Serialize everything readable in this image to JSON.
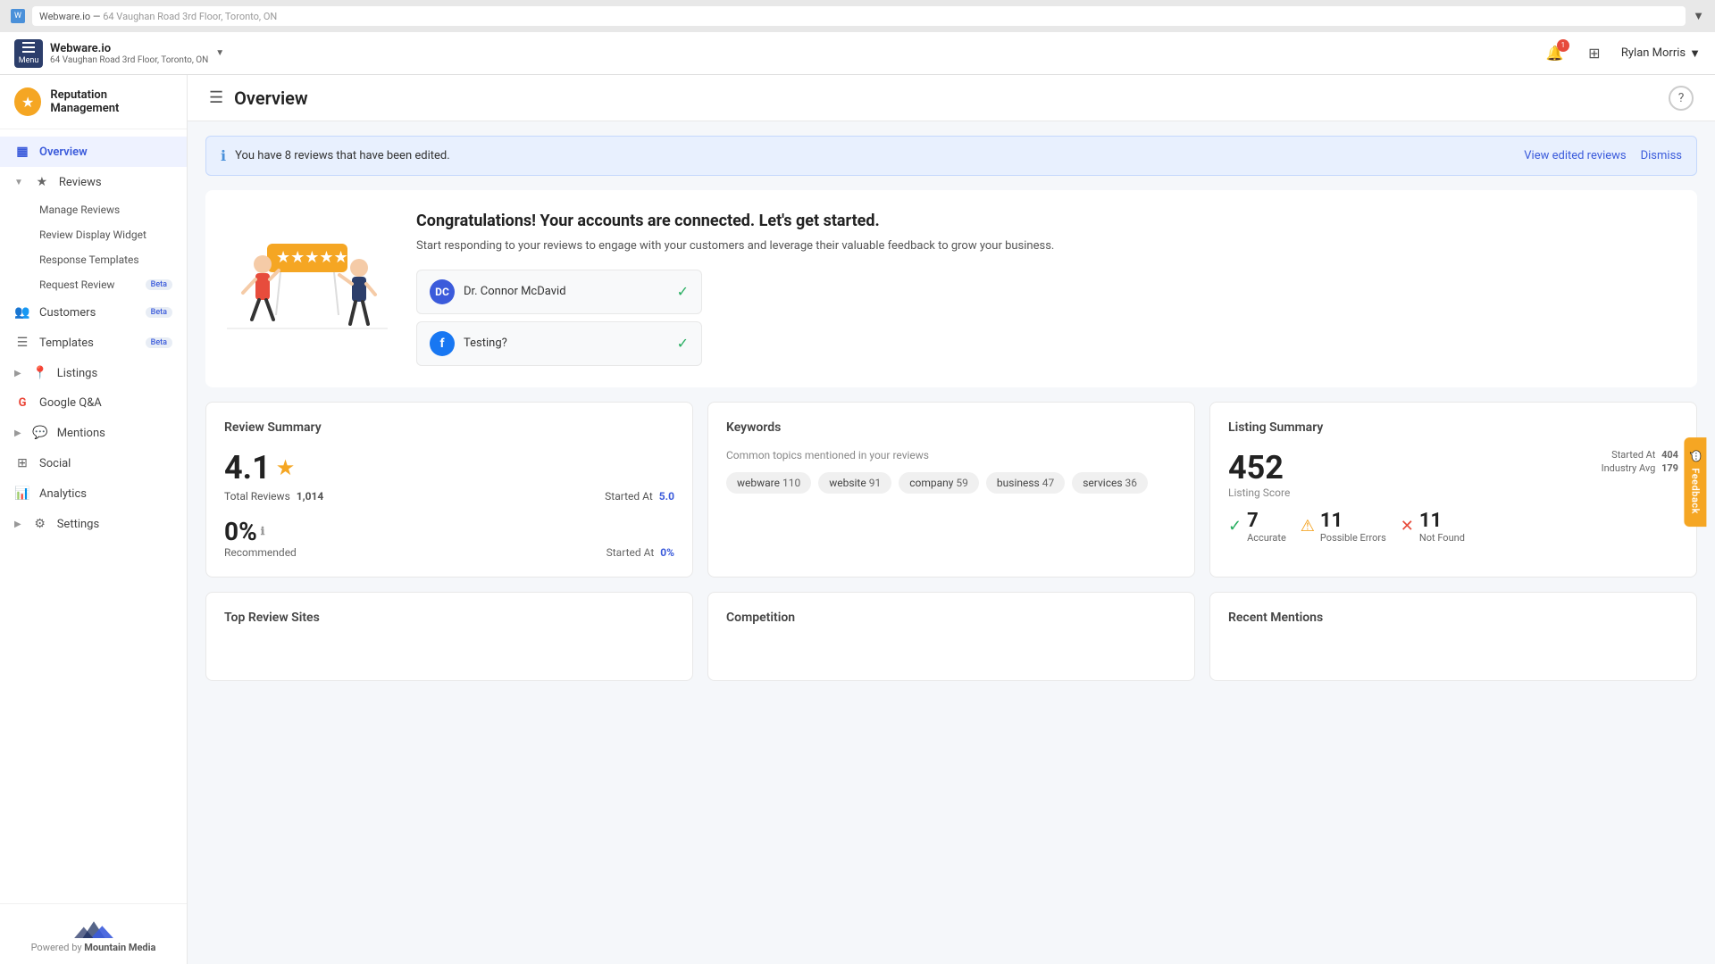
{
  "browser": {
    "company": "Webware.io",
    "address": "64 Vaughan Road 3rd Floor, Toronto, ON",
    "menu_label": "Menu",
    "user": "Rylan Morris"
  },
  "header": {
    "page_title": "Overview",
    "notif_count": "1"
  },
  "sidebar": {
    "brand_name": "Reputation Management",
    "nav_items": [
      {
        "id": "overview",
        "label": "Overview",
        "icon": "▦",
        "active": true
      },
      {
        "id": "reviews",
        "label": "Reviews",
        "icon": "★",
        "expandable": true
      },
      {
        "id": "manage-reviews",
        "label": "Manage Reviews",
        "sub": true
      },
      {
        "id": "review-display-widget",
        "label": "Review Display Widget",
        "sub": true
      },
      {
        "id": "response-templates",
        "label": "Response Templates",
        "sub": true
      },
      {
        "id": "request-review",
        "label": "Request Review",
        "sub": true,
        "badge": "Beta"
      },
      {
        "id": "customers",
        "label": "Customers",
        "icon": "👥",
        "badge": "Beta"
      },
      {
        "id": "templates",
        "label": "Templates",
        "icon": "☰",
        "badge": "Beta"
      },
      {
        "id": "listings",
        "label": "Listings",
        "icon": "📍",
        "expandable": true
      },
      {
        "id": "google-qa",
        "label": "Google Q&A",
        "icon": "G"
      },
      {
        "id": "mentions",
        "label": "Mentions",
        "icon": "💬",
        "expandable": true
      },
      {
        "id": "social",
        "label": "Social",
        "icon": "⊞"
      },
      {
        "id": "analytics",
        "label": "Analytics",
        "icon": "📊"
      },
      {
        "id": "settings",
        "label": "Settings",
        "icon": "⚙",
        "expandable": true
      }
    ],
    "footer_powered_by": "Powered by",
    "footer_company": "Mountain Media"
  },
  "info_banner": {
    "message": "You have 8 reviews that have been edited.",
    "view_link": "View edited reviews",
    "dismiss": "Dismiss"
  },
  "welcome": {
    "title": "Congratulations! Your accounts are connected. Let's get started.",
    "description": "Start responding to your reviews to engage with your customers and leverage their valuable feedback to grow your business.",
    "connected_accounts": [
      {
        "id": "dr-connor",
        "name": "Dr. Connor McDavid",
        "initials": "DC",
        "type": "blue"
      },
      {
        "id": "testing",
        "name": "Testing?",
        "initials": "f",
        "type": "fb"
      }
    ]
  },
  "review_summary": {
    "title": "Review Summary",
    "rating": "4.1",
    "total_reviews_label": "Total Reviews",
    "total_reviews_value": "1,014",
    "started_at_label": "Started At",
    "started_at_value": "5.0",
    "recommended_percent": "0%",
    "recommended_label": "Recommended",
    "rec_started_at_label": "Started At",
    "rec_started_at_value": "0%"
  },
  "keywords": {
    "title": "Keywords",
    "description": "Common topics mentioned in your reviews",
    "tags": [
      {
        "word": "webware",
        "count": "110"
      },
      {
        "word": "website",
        "count": "91"
      },
      {
        "word": "company",
        "count": "59"
      },
      {
        "word": "business",
        "count": "47"
      },
      {
        "word": "services",
        "count": "36"
      }
    ]
  },
  "listing_summary": {
    "title": "Listing Summary",
    "score": "452",
    "score_label": "Listing Score",
    "started_at": "404",
    "started_at_label": "Started At",
    "industry_avg": "179",
    "industry_avg_label": "Industry Avg",
    "stats": [
      {
        "id": "accurate",
        "value": "7",
        "label": "Accurate",
        "type": "green"
      },
      {
        "id": "possible-errors",
        "value": "11",
        "label": "Possible Errors",
        "type": "orange"
      },
      {
        "id": "not-found",
        "value": "11",
        "label": "Not Found",
        "type": "red"
      }
    ]
  },
  "bottom_cards": [
    {
      "id": "top-review-sites",
      "title": "Top Review Sites"
    },
    {
      "id": "competition",
      "title": "Competition"
    },
    {
      "id": "recent-mentions",
      "title": "Recent Mentions"
    }
  ],
  "feedback_tab": "Feedback"
}
